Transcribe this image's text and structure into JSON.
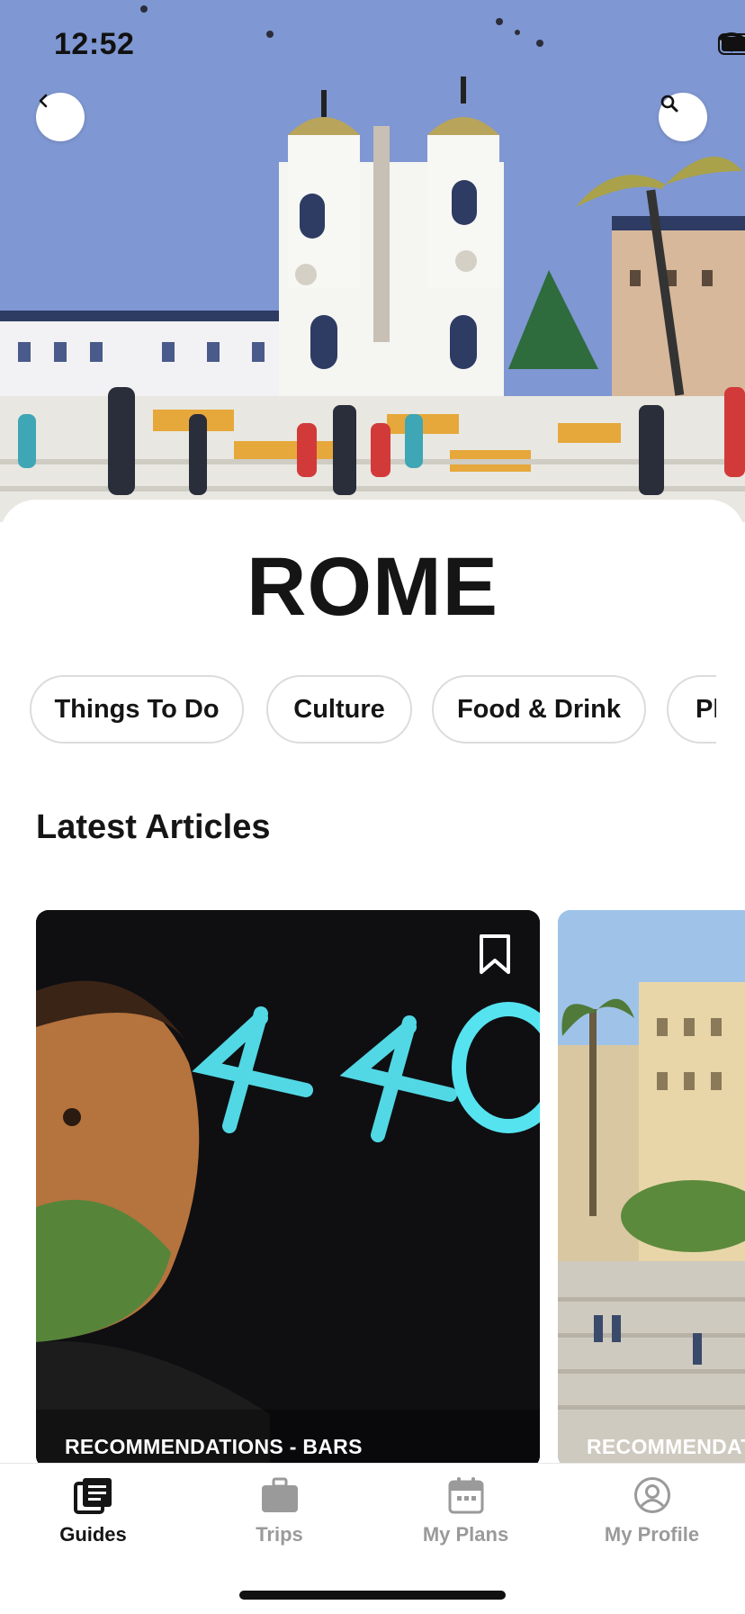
{
  "status_bar": {
    "time": "12:52"
  },
  "header": {
    "city": "ROME"
  },
  "categories": [
    "Things To Do",
    "Culture",
    "Food & Drink",
    "Pl"
  ],
  "latest": {
    "title": "Latest Articles",
    "articles": [
      {
        "label": "RECOMMENDATIONS - BARS"
      },
      {
        "label": "RECOMMENDAT"
      }
    ]
  },
  "tabs": [
    {
      "label": "Guides",
      "icon": "guides-icon",
      "active": true
    },
    {
      "label": "Trips",
      "icon": "briefcase-icon",
      "active": false
    },
    {
      "label": "My Plans",
      "icon": "calendar-icon",
      "active": false
    },
    {
      "label": "My Profile",
      "icon": "profile-icon",
      "active": false
    }
  ],
  "colors": {
    "accent": "#151515",
    "inactive": "#9a9a9a",
    "sky": "#7f97d2"
  }
}
